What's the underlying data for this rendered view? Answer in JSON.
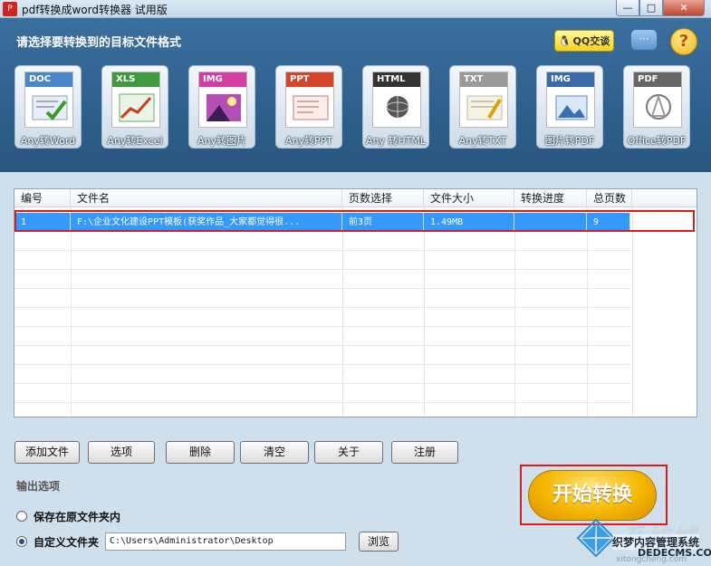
{
  "window": {
    "title": "pdf转换成word转换器 试用版",
    "min_glyph": "—",
    "max_glyph": "□",
    "close_glyph": "✕"
  },
  "header": {
    "prompt": "请选择要转换到的目标文件格式",
    "qq_label": "QQ交谈",
    "chat_glyph": "···",
    "help_glyph": "?"
  },
  "tools": [
    {
      "tag": "DOC",
      "label": "Any转Word",
      "color": "#4a86c8"
    },
    {
      "tag": "XLS",
      "label": "Any转Excel",
      "color": "#3f9a3f"
    },
    {
      "tag": "IMG",
      "label": "Any转图片",
      "color": "#d13fa2"
    },
    {
      "tag": "PPT",
      "label": "Any转PPT",
      "color": "#d5452b"
    },
    {
      "tag": "HTML",
      "label": "Any 转HTML",
      "color": "#333333"
    },
    {
      "tag": "TXT",
      "label": "Any转TXT",
      "color": "#9a9a9a"
    },
    {
      "tag": "IMG",
      "label": "图片转PDF",
      "color": "#3a6aa8"
    },
    {
      "tag": "PDF",
      "label": "Office转PDF",
      "color": "#666666"
    }
  ],
  "table": {
    "headers": [
      "编号",
      "文件名",
      "页数选择",
      "文件大小",
      "转换进度",
      "总页数"
    ],
    "rows": [
      [
        "1",
        "F:\\企业文化建设PPT模板(获奖作品_大家都觉得很...",
        "前3页",
        "1.49MB",
        "",
        "9"
      ]
    ]
  },
  "actions": [
    "添加文件",
    "选项",
    "删除",
    "清空",
    "关于",
    "注册"
  ],
  "output": {
    "section_label": "输出选项",
    "option_original": "保存在原文件夹内",
    "option_custom": "自定义文件夹",
    "path": "C:\\Users\\Administrator\\Desktop",
    "browse_label": "浏览",
    "selected": "custom"
  },
  "start_label": "开始转换",
  "watermark": {
    "brand": "系统城",
    "cn": "织梦内容管理系统",
    "url": "DEDECMS.COM",
    "sub": "xitongcheng.com"
  },
  "colors": {
    "selection": "#3399ff",
    "highlight_frame": "#d81c1c",
    "start_button": "#f5b600"
  }
}
